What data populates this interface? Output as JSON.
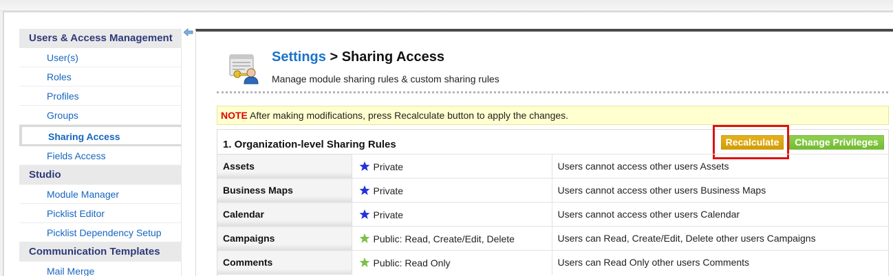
{
  "sidebar": {
    "sections": [
      {
        "header": "Users & Access Management",
        "items": [
          {
            "label": "User(s)"
          },
          {
            "label": "Roles"
          },
          {
            "label": "Profiles"
          },
          {
            "label": "Groups"
          },
          {
            "label": "Sharing Access",
            "active": true
          },
          {
            "label": "Fields Access"
          }
        ]
      },
      {
        "header": "Studio",
        "items": [
          {
            "label": "Module Manager"
          },
          {
            "label": "Picklist Editor"
          },
          {
            "label": "Picklist Dependency Setup"
          }
        ]
      },
      {
        "header": "Communication Templates",
        "items": [
          {
            "label": "Mail Merge"
          }
        ]
      }
    ]
  },
  "header": {
    "breadcrumb_link": "Settings",
    "breadcrumb_sep": " > ",
    "title": "Sharing Access",
    "subtitle": "Manage module sharing rules & custom sharing rules"
  },
  "note": {
    "label": "NOTE",
    "text": " After making modifications, press Recalculate button to apply the changes."
  },
  "rules": {
    "title": "1. Organization-level Sharing Rules",
    "recalculate_label": "Recalculate",
    "change_privileges_label": "Change Privileges",
    "rows": [
      {
        "module": "Assets",
        "access": "Private",
        "star_color": "#2233dd",
        "description": "Users cannot access other users Assets"
      },
      {
        "module": "Business Maps",
        "access": "Private",
        "star_color": "#2233dd",
        "description": "Users cannot access other users Business Maps"
      },
      {
        "module": "Calendar",
        "access": "Private",
        "star_color": "#2233dd",
        "description": "Users cannot access other users Calendar"
      },
      {
        "module": "Campaigns",
        "access": "Public: Read, Create/Edit, Delete",
        "star_color": "#7cc04a",
        "description": "Users can Read, Create/Edit, Delete other users Campaigns"
      },
      {
        "module": "Comments",
        "access": "Public: Read Only",
        "star_color": "#7cc04a",
        "description": "Users can Read Only other users Comments"
      }
    ]
  },
  "colors": {
    "accent_link": "#1a73c8",
    "section_header": "#2e3a7a",
    "note_label": "#e00000",
    "recalculate_button": "#dea50f",
    "change_privileges_button": "#82c641",
    "highlight": "#e01010"
  }
}
